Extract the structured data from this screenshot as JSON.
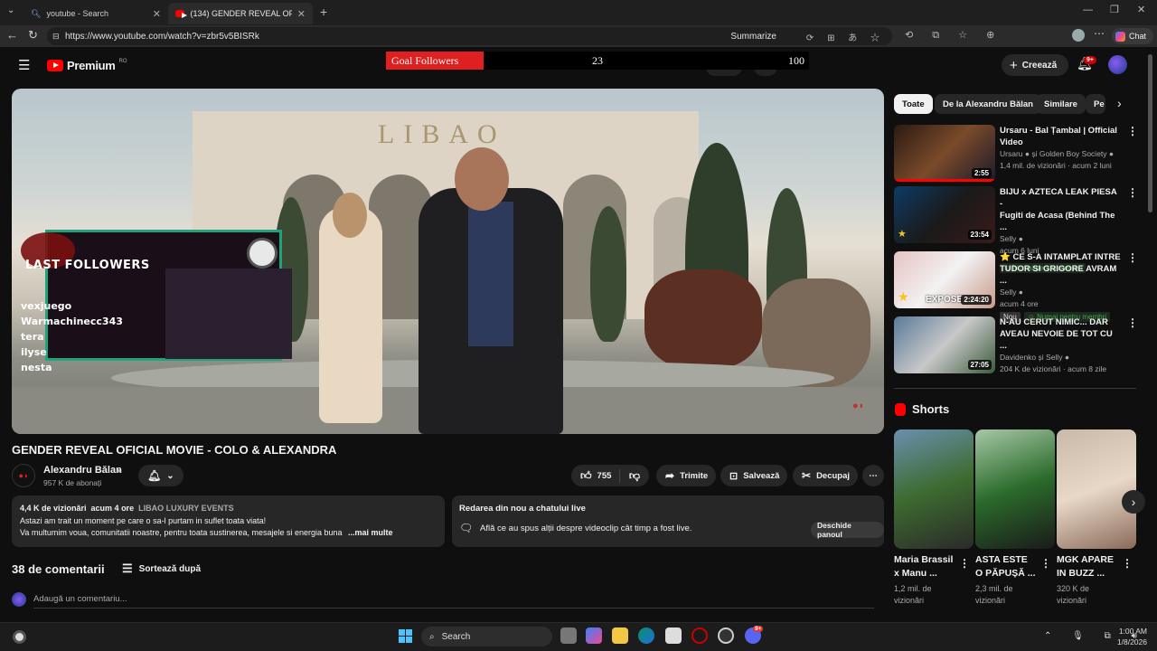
{
  "browser": {
    "tabs": [
      {
        "title": "youtube - Search"
      },
      {
        "title": "(134) GENDER REVEAL OFICIAL M"
      }
    ],
    "url": "https://www.youtube.com/watch?v=zbr5v5BISRk",
    "summarize": "Summarize",
    "chat": "Chat"
  },
  "youtube": {
    "brand": "Premium",
    "region": "RO",
    "create_label": "Creează",
    "notif_count": "9+"
  },
  "goal_overlay": {
    "label": "Goal Followers",
    "current": "23",
    "target": "100",
    "progress_fraction": 0.23
  },
  "followers_overlay": {
    "title": "LAST FOLLOWERS",
    "names": [
      "vexjuego",
      "Warmachinecc343",
      "tera",
      "ilyse",
      "nesta"
    ]
  },
  "video": {
    "sign": "LIBAO",
    "title": "GENDER REVEAL OFICIAL MOVIE - COLO & ALEXANDRA",
    "channel": "Alexandru Bălan",
    "subs": "957 K de abonați",
    "likes": "755",
    "share": "Trimite",
    "save": "Salvează",
    "clip": "Decupaj"
  },
  "description": {
    "views": "4,4 K de vizionări",
    "age": "acum 4 ore",
    "tag": "LIBAO LUXURY EVENTS",
    "line1": "Astazi am trait un moment pe care o sa-l purtam in suflet toata viata!",
    "line2": "Va multumim voua, comunitatii noastre, pentru toata sustinerea, mesajele si energia buna",
    "more": "...mai multe"
  },
  "live_chat": {
    "title": "Redarea din nou a chatului live",
    "text": "Află ce au spus alții despre videoclip cât timp a fost live.",
    "button": "Deschide panoul"
  },
  "comments": {
    "count": "38 de comentarii",
    "sort": "Sortează după",
    "placeholder": "Adaugă un comentariu..."
  },
  "chips": [
    "Toate",
    "De la Alexandru Bălan",
    "Similare",
    "Pe"
  ],
  "related": [
    {
      "title1": "Ursaru - Bal Țambal | Official",
      "title2": "Video",
      "channel": "Ursaru",
      "channel_extra": "și Golden Boy Society",
      "meta": "1,4 mil. de vizionări · acum 2 luni",
      "duration": "2:55"
    },
    {
      "title1": "BIJU x AZTECA LEAK PIESA -",
      "title2": "Fugiti de Acasa (Behind The ...",
      "channel": "Selly",
      "meta": "acum 6 luni",
      "badge": "Numai pentru membri",
      "duration": "23:54"
    },
    {
      "title1": "⭐ CE S-A INTAMPLAT INTRE",
      "title2": "TUDOR SI GRIGORE AVRAM ...",
      "channel": "Selly",
      "meta": "acum 4 ore",
      "new": "Nou",
      "badge": "Numai pentru membri",
      "duration": "2:24:20",
      "thumb_text": "EXPOSE"
    },
    {
      "title1": "N-AU CERUT NIMIC... DAR",
      "title2": "AVEAU NEVOIE DE TOT CU ...",
      "channel": "Davidenko și Selly",
      "meta": "204 K de vizionări · acum 8 zile",
      "duration": "27:05"
    }
  ],
  "shorts": {
    "heading": "Shorts",
    "items": [
      {
        "t1": "Maria Brassil",
        "t2": "x Manu ...",
        "v1": "1,2 mil. de",
        "v2": "vizionări"
      },
      {
        "t1": "ASTA ESTE",
        "t2": "O PĂPUȘĂ ...",
        "v1": "2,3 mil. de",
        "v2": "vizionări"
      },
      {
        "t1": "MGK APARE",
        "t2": "IN BUZZ ...",
        "v1": "320 K de",
        "v2": "vizionări"
      }
    ]
  },
  "taskbar": {
    "search": "Search",
    "time": "1:00 AM",
    "date": "1/8/2026",
    "discord_badge": "9+"
  }
}
